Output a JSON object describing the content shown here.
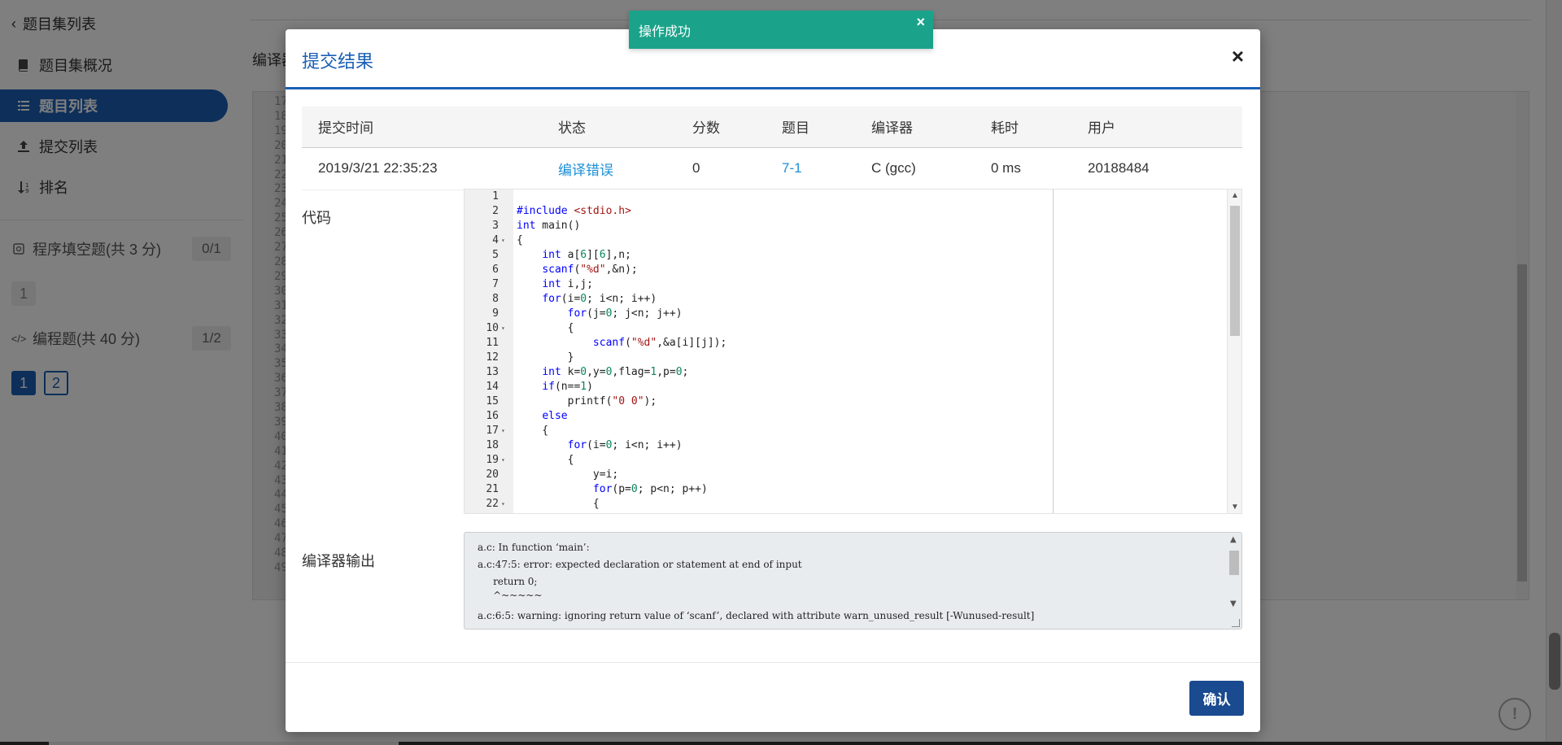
{
  "sidebar": {
    "back_label": "题目集列表",
    "nav": [
      {
        "label": "题目集概况",
        "icon": "book-icon"
      },
      {
        "label": "题目列表",
        "icon": "list-icon"
      },
      {
        "label": "提交列表",
        "icon": "upload-icon"
      },
      {
        "label": "排名",
        "icon": "sort-icon"
      }
    ],
    "sections": [
      {
        "label": "程序填空题(共 3 分)",
        "count": "0/1",
        "icon": "fill-blank-icon",
        "questions": [
          "1"
        ]
      },
      {
        "label": "编程题(共 40 分)",
        "count": "1/2",
        "icon": "code-icon",
        "questions": [
          "1",
          "2"
        ]
      }
    ]
  },
  "background": {
    "compiler_label": "编译器",
    "line_numbers": [
      "17",
      "18",
      "19",
      "20",
      "21",
      "22",
      "23",
      "24",
      "25",
      "26",
      "27",
      "28",
      "29",
      "30",
      "31",
      "32",
      "33",
      "34",
      "35",
      "36",
      "37",
      "38",
      "39",
      "40",
      "41",
      "42",
      "43",
      "44",
      "45",
      "46",
      "47",
      "48",
      "49"
    ]
  },
  "toast": {
    "message": "操作成功"
  },
  "modal": {
    "title": "提交结果",
    "close": "×",
    "table": {
      "headers": [
        "提交时间",
        "状态",
        "分数",
        "题目",
        "编译器",
        "耗时",
        "用户"
      ],
      "row": {
        "time": "2019/3/21 22:35:23",
        "status": "编译错误",
        "score": "0",
        "problem": "7-1",
        "compiler": "C (gcc)",
        "elapsed": "0 ms",
        "user": "20188484"
      }
    },
    "code_label": "代码",
    "code_lines": [
      {
        "n": "1",
        "fold": false,
        "html": ""
      },
      {
        "n": "2",
        "fold": false,
        "html": "<span class=\"kw\">#include</span> <span class=\"str\">&lt;stdio.h&gt;</span>"
      },
      {
        "n": "3",
        "fold": false,
        "html": "<span class=\"kw\">int</span> main()"
      },
      {
        "n": "4",
        "fold": true,
        "html": "{"
      },
      {
        "n": "5",
        "fold": false,
        "html": "    <span class=\"kw\">int</span> a[<span class=\"num\">6</span>][<span class=\"num\">6</span>],n;"
      },
      {
        "n": "6",
        "fold": false,
        "html": "    <span class=\"kw\">scanf</span>(<span class=\"str\">\"%d\"</span>,&amp;n);"
      },
      {
        "n": "7",
        "fold": false,
        "html": "    <span class=\"kw\">int</span> i,j;"
      },
      {
        "n": "8",
        "fold": false,
        "html": "    <span class=\"kw\">for</span>(i=<span class=\"num\">0</span>; i&lt;n; i++)"
      },
      {
        "n": "9",
        "fold": false,
        "html": "        <span class=\"kw\">for</span>(j=<span class=\"num\">0</span>; j&lt;n; j++)"
      },
      {
        "n": "10",
        "fold": true,
        "html": "        {"
      },
      {
        "n": "11",
        "fold": false,
        "html": "            <span class=\"kw\">scanf</span>(<span class=\"str\">\"%d\"</span>,&amp;a[i][j]);"
      },
      {
        "n": "12",
        "fold": false,
        "html": "        }"
      },
      {
        "n": "13",
        "fold": false,
        "html": "    <span class=\"kw\">int</span> k=<span class=\"num\">0</span>,y=<span class=\"num\">0</span>,flag=<span class=\"num\">1</span>,p=<span class=\"num\">0</span>;"
      },
      {
        "n": "14",
        "fold": false,
        "html": "    <span class=\"kw\">if</span>(n==<span class=\"num\">1</span>)"
      },
      {
        "n": "15",
        "fold": false,
        "html": "        printf(<span class=\"str\">\"0 0\"</span>);"
      },
      {
        "n": "16",
        "fold": false,
        "html": "    <span class=\"kw\">else</span>"
      },
      {
        "n": "17",
        "fold": true,
        "html": "    {"
      },
      {
        "n": "18",
        "fold": false,
        "html": "        <span class=\"kw\">for</span>(i=<span class=\"num\">0</span>; i&lt;n; i++)"
      },
      {
        "n": "19",
        "fold": true,
        "html": "        {"
      },
      {
        "n": "20",
        "fold": false,
        "html": "            y=i;"
      },
      {
        "n": "21",
        "fold": false,
        "html": "            <span class=\"kw\">for</span>(p=<span class=\"num\">0</span>; p&lt;n; p++)"
      },
      {
        "n": "22",
        "fold": true,
        "html": "            {"
      }
    ],
    "output_label": "编译器输出",
    "output_lines": [
      "a.c: In function ‘main’:",
      "a.c:47:5: error: expected declaration or statement at end of input",
      "     return 0;",
      "     ^~~~~~",
      "a.c:6:5: warning: ignoring return value of ‘scanf’, declared with attribute warn_unused_result [-Wunused-result]"
    ],
    "confirm_label": "确认"
  }
}
